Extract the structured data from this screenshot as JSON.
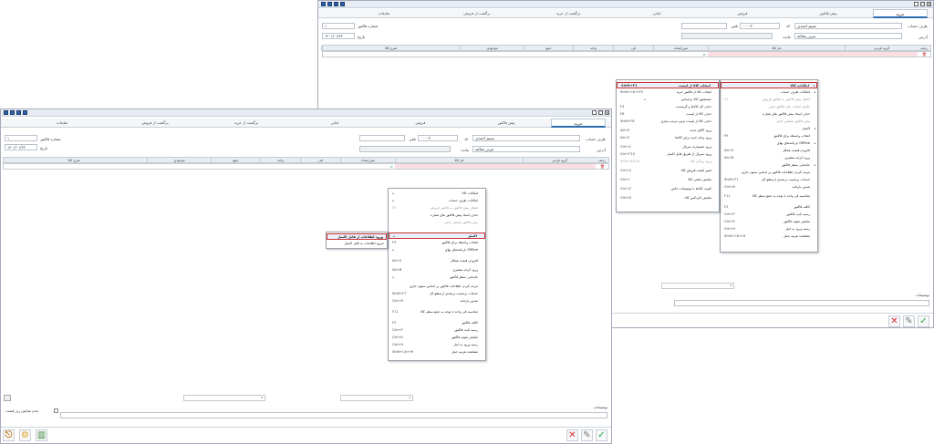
{
  "window": {
    "ctl_min": "_",
    "ctl_max": "□",
    "ctl_close": "×"
  },
  "tabs": [
    "خرید",
    "پیش فاکتور",
    "فروش",
    "امانی",
    "برگشت از خرید",
    "برگشت از فروش",
    "ضایعات"
  ],
  "form": {
    "account_side_label": "طرف حساب",
    "account_side_value": "نسیم احمدی",
    "code_label": "کد",
    "code_value": "۰۰۰۰۳",
    "phone_label": "تلفن",
    "address_label": "آدرس",
    "address_value": "تبریز_عمالیه",
    "invoice_no_label": "شماره فاکتور",
    "invoice_no_value": "۱",
    "date_label": "تاریخ",
    "date_value": "۱۴۰۱/۰۱/۲۲",
    "balance_label": "مانده"
  },
  "grid": {
    "headers": [
      "ردیف",
      "گروه فرعی",
      "نام کالا",
      "مترژ/تعداد",
      "فی",
      "واحد",
      "جمع",
      "موجودی",
      "شرح کالا"
    ]
  },
  "menu_main": {
    "items": [
      {
        "t": "امکانات کالا",
        "s": "",
        "arrow": true
      },
      {
        "t": "امکانات طرف حساب",
        "s": "",
        "arrow": true
      },
      {
        "t": "انتقال پیش فاکتور به فاکتور فروش",
        "s": "F5",
        "dis": true
      },
      {
        "t": "تکمیل انتخاب های فاکتور تغییر",
        "s": "",
        "dis": true
      },
      {
        "t": "حذف اسناد پیش فاکتور های شناره",
        "s": ""
      },
      {
        "t": "پیش فاکتور شخص خاص",
        "s": "",
        "dis": true
      },
      {
        "t": "اکسل",
        "s": "",
        "arrow": true,
        "hl": true
      },
      {
        "t": "انتخاب واسطه برای فاکتور",
        "s": "F9"
      },
      {
        "t": "بارنامه‌های بهای Offline",
        "s": "",
        "arrow": true
      },
      {
        "t": "افزودن قیمت همکار",
        "s": "Alt+S"
      },
      {
        "t": "ورود کرایه مشتری",
        "s": "Alt+B"
      },
      {
        "t": "جابجایی سطر فاکتور",
        "s": "",
        "arrow": true
      },
      {
        "t": "مرتب کردن اطلاعات فاکتور بر اساس ستون جاری",
        "s": ""
      },
      {
        "t": "خدمات برچسب درصدی ارسطو کل",
        "s": "Shift+F7"
      },
      {
        "t": "صدور بارنامه",
        "s": "Ctrl+B"
      },
      {
        "t": "محاسبه فی واحد با توجه به جمع سطر کالا",
        "s": "F11"
      },
      {
        "t": "کالف فاکتور",
        "s": "F2"
      },
      {
        "t": "رسید ثابت فاکتور",
        "s": "Ctrl+P"
      },
      {
        "t": "نمایش نمونه فاکتور",
        "s": "Ctrl+K"
      },
      {
        "t": "رسید ورود به انبار",
        "s": "Ctrl+H"
      },
      {
        "t": "مشاهده هزینه حمل",
        "s": "Shift+Ctrl+H"
      }
    ]
  },
  "submenu_excel": [
    "ورود اطلاعات از فایل اکسل",
    "خروج اطلاعات به فایل اکسل"
  ],
  "submenu_goods": {
    "items": [
      {
        "t": "انتخاب کالا از لیست",
        "s": "Shift+F1",
        "hl": true
      },
      {
        "t": "انتخاب کالا از فاکتور خرید",
        "s": "Shift+Ctrl+F5"
      },
      {
        "t": "جستجوی کالا براساس",
        "s": "",
        "arrow": true
      },
      {
        "t": "حذف کل کالاها و گزینست",
        "s": "F4"
      },
      {
        "t": "حذف کالا از لیست",
        "s": "F8"
      },
      {
        "t": "حذف کالا از لیست بدون مرتب سازی",
        "s": "Shift+F8"
      },
      {
        "t": "ورود گالای جدید",
        "s": "Alt+S"
      },
      {
        "t": "ورود واحد جدید برای کالاها",
        "s": "Alt+Z"
      },
      {
        "t": "ورود شسیارنه سریال",
        "s": "Ctrl+S"
      },
      {
        "t": "ورود سریال از طریق فایل اکسل",
        "s": "Ctrl+F10"
      },
      {
        "t": "ورود ویژگی کالا",
        "s": "Shift+Alt+A",
        "dis": true
      },
      {
        "t": "تغییر قیمت فروش کالا",
        "s": "Ctrl+G"
      },
      {
        "t": "نمایش مانعی کالا",
        "s": "Ctrl+I"
      },
      {
        "t": "کمیت کالاها با توضیحات خاص",
        "s": "Ctrl+Z"
      },
      {
        "t": "نمایش کاردکس کالا",
        "s": "Ctrl+D"
      }
    ]
  },
  "bottom": {
    "notes_label": "توضیحات",
    "hide_price_label": "عدم نمایش ریز قیمت"
  }
}
